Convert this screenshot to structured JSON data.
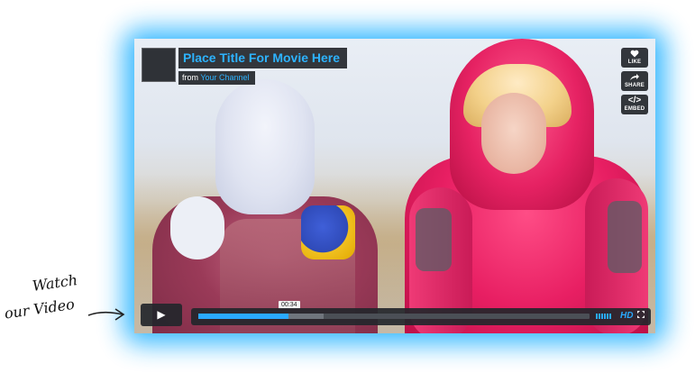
{
  "player": {
    "title": "Place Title For Movie Here",
    "from_prefix": "from",
    "channel": "Your Channel",
    "actions": [
      {
        "icon": "heart-icon",
        "label": "LIKE"
      },
      {
        "icon": "share-icon",
        "label": "SHARE"
      },
      {
        "icon": "embed-icon",
        "label": "EMBED"
      }
    ],
    "controls": {
      "timecode": "00:34",
      "progress_played": 0.23,
      "progress_loaded": 0.32,
      "hd_label": "HD",
      "play_icon": "play-icon",
      "fullscreen_icon": "fullscreen-icon"
    }
  },
  "note": {
    "line1": "Watch",
    "line2": "our Video"
  },
  "colors": {
    "glow": "#2fb6ff",
    "accent": "#2db3ff",
    "overlay": "#23262b"
  }
}
